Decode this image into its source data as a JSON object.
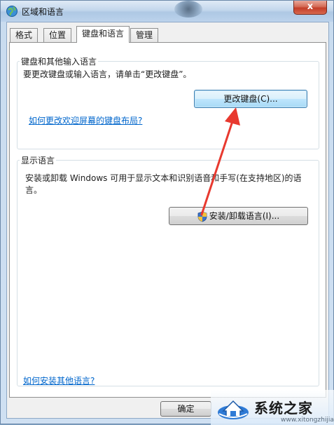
{
  "window": {
    "title": "区域和语言",
    "close_label": "x"
  },
  "tabs": [
    {
      "label": "格式",
      "active": false
    },
    {
      "label": "位置",
      "active": false
    },
    {
      "label": "键盘和语言",
      "active": true
    },
    {
      "label": "管理",
      "active": false
    }
  ],
  "keyboard_group": {
    "legend": "键盘和其他输入语言",
    "description": "要更改键盘或输入语言，请单击“更改键盘”。",
    "button_label": "更改键盘(C)...",
    "welcome_link": "如何更改欢迎屏幕的键盘布局?"
  },
  "display_group": {
    "legend": "显示语言",
    "description": "安装或卸载 Windows 可用于显示文本和识别语音和手写(在支持地区)的语言。",
    "button_label": "安装/卸载语言(I)..."
  },
  "footer": {
    "install_link": "如何安装其他语言?",
    "ok_label": "确定"
  },
  "watermark": {
    "brand": "系统之家",
    "url": "www.xitongzhijia.net"
  },
  "colors": {
    "accent_arrow": "#e8392f",
    "link": "#0066cc"
  }
}
